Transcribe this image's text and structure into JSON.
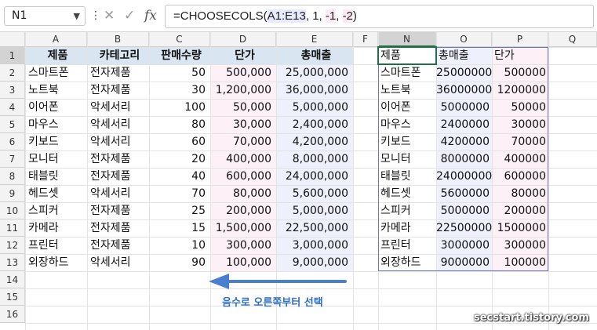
{
  "formula_bar": {
    "name_box": "N1",
    "cancel_icon": "✕",
    "enter_icon": "✓",
    "fx_label": "fx",
    "formula_parts": [
      "=CHOOSECOLS(",
      "A1:E13",
      ", ",
      "1",
      ", ",
      "-1",
      ", ",
      "-2",
      ")"
    ]
  },
  "columns": [
    "A",
    "B",
    "C",
    "D",
    "E",
    "F",
    "N",
    "O",
    "P",
    "Q"
  ],
  "rows": [
    "1",
    "2",
    "3",
    "4",
    "5",
    "6",
    "7",
    "8",
    "9",
    "10",
    "11",
    "12",
    "13",
    "14",
    "15",
    "16"
  ],
  "source_table": [
    [
      "제품",
      "카테고리",
      "판매수량",
      "단가",
      "총매출"
    ],
    [
      "스마트폰",
      "전자제품",
      "50",
      "500,000",
      "25,000,000"
    ],
    [
      "노트북",
      "전자제품",
      "30",
      "1,200,000",
      "36,000,000"
    ],
    [
      "이어폰",
      "악세서리",
      "100",
      "50,000",
      "5,000,000"
    ],
    [
      "마우스",
      "악세서리",
      "80",
      "30,000",
      "2,400,000"
    ],
    [
      "키보드",
      "악세서리",
      "60",
      "70,000",
      "4,200,000"
    ],
    [
      "모니터",
      "전자제품",
      "20",
      "400,000",
      "8,000,000"
    ],
    [
      "태블릿",
      "전자제품",
      "40",
      "600,000",
      "24,000,000"
    ],
    [
      "헤드셋",
      "악세서리",
      "70",
      "80,000",
      "5,600,000"
    ],
    [
      "스피커",
      "전자제품",
      "25",
      "200,000",
      "5,000,000"
    ],
    [
      "카메라",
      "전자제품",
      "15",
      "1,500,000",
      "22,500,000"
    ],
    [
      "프린터",
      "전자제품",
      "10",
      "300,000",
      "3,000,000"
    ],
    [
      "외장하드",
      "악세서리",
      "90",
      "100,000",
      "9,000,000"
    ]
  ],
  "result_table": [
    [
      "제품",
      "총매출",
      "단가"
    ],
    [
      "스마트폰",
      "25000000",
      "500000"
    ],
    [
      "노트북",
      "36000000",
      "1200000"
    ],
    [
      "이어폰",
      "5000000",
      "50000"
    ],
    [
      "마우스",
      "2400000",
      "30000"
    ],
    [
      "키보드",
      "4200000",
      "70000"
    ],
    [
      "모니터",
      "8000000",
      "400000"
    ],
    [
      "태블릿",
      "24000000",
      "600000"
    ],
    [
      "헤드셋",
      "5600000",
      "80000"
    ],
    [
      "스피커",
      "5000000",
      "200000"
    ],
    [
      "카메라",
      "22500000",
      "1500000"
    ],
    [
      "프린터",
      "3000000",
      "300000"
    ],
    [
      "외장하드",
      "9000000",
      "100000"
    ]
  ],
  "annotation": "음수로 오른쪽부터 선택",
  "watermark": "secstart.tistory.com",
  "colors": {
    "header_row_bg": "#d9e5f1",
    "highlight_D": "#fdf0f7",
    "highlight_E": "#eef0fc",
    "spill_border": "#6b74c9",
    "active_cell_border": "#1e7145",
    "annotation": "#2c6eca"
  }
}
